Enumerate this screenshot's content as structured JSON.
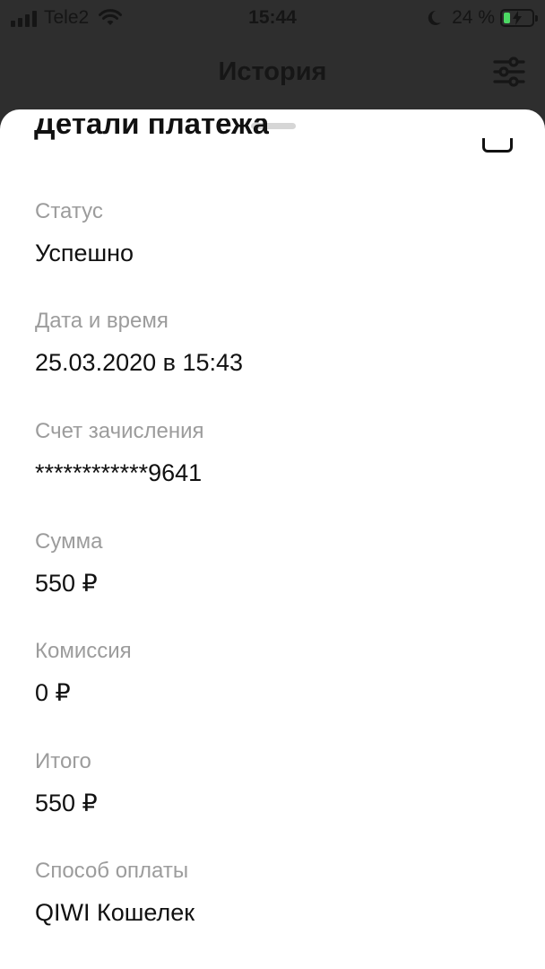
{
  "status_bar": {
    "carrier": "Tele2",
    "time": "15:44",
    "battery": "24 %",
    "battery_level": 0.24,
    "icons": [
      "signal-icon",
      "wifi-icon",
      "moon-icon",
      "battery-icon"
    ]
  },
  "nav": {
    "title": "История",
    "filter_icon": "filter-sliders-icon"
  },
  "sheet": {
    "title": "Детали платежа",
    "close_icon": "close-icon",
    "fields": [
      {
        "label": "Статус",
        "value": "Успешно"
      },
      {
        "label": "Дата и время",
        "value": "25.03.2020 в 15:43"
      },
      {
        "label": "Счет зачисления",
        "value": "************9641"
      },
      {
        "label": "Сумма",
        "value": "550 ₽"
      },
      {
        "label": "Комиссия",
        "value": "0 ₽"
      },
      {
        "label": "Итого",
        "value": "550 ₽"
      },
      {
        "label": "Способ оплаты",
        "value": "QIWI Кошелек"
      }
    ]
  },
  "colors": {
    "backdrop": "#2e2e2e",
    "sheet": "#ffffff",
    "label": "#9c9c9c",
    "value": "#111111",
    "battery_fill": "#4cd964"
  }
}
